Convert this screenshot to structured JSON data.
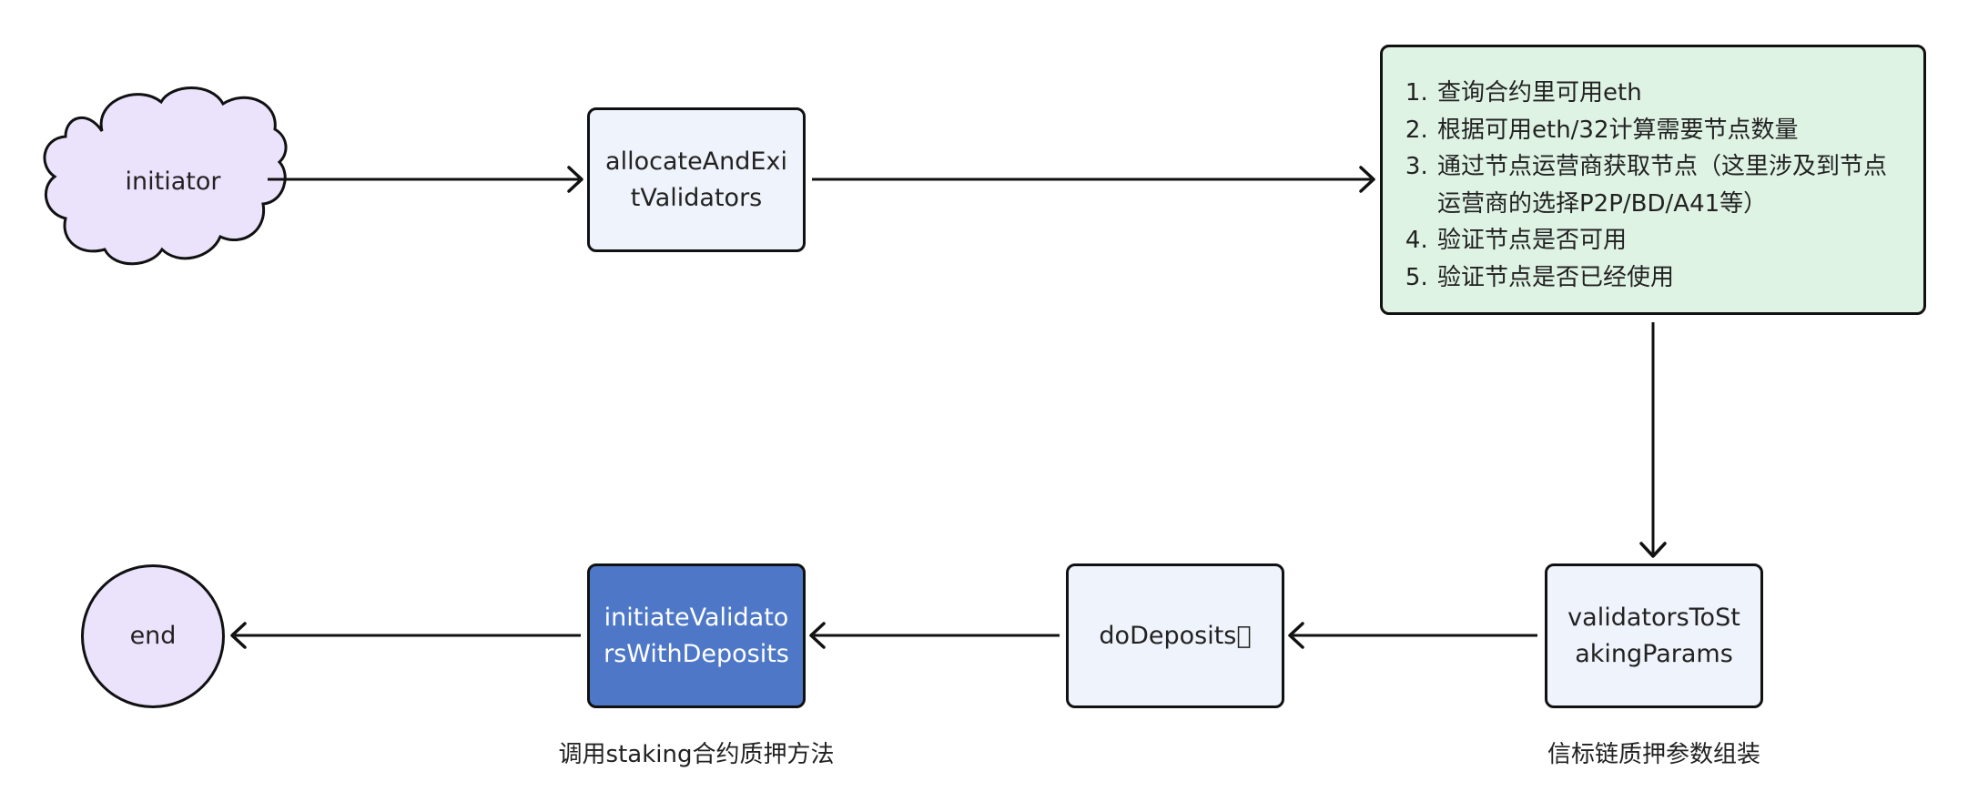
{
  "nodes": {
    "initiator": "initiator",
    "allocate": "allocateAndExitValidators",
    "validators_to_staking": "validatorsToStakingParams",
    "do_deposits": "doDeposits\u0000",
    "initiate": "initiateValidatorsWithDeposits",
    "end": "end"
  },
  "note": {
    "items": [
      "查询合约里可用eth",
      "根据可用eth/32计算需要节点数量",
      "通过节点运营商获取节点（这里涉及到节点运营商的选择P2P/BD/A41等）",
      "验证节点是否可用",
      "验证节点是否已经使用"
    ]
  },
  "captions": {
    "staking_call": "调用staking合约质押方法",
    "beacon_params": "信标链质押参数组装"
  },
  "colors": {
    "cloud_fill": "#ebe3fb",
    "box_fill": "#eff3fb",
    "note_fill": "#dff3e4",
    "highlight_fill": "#4e78c7",
    "end_fill": "#ebe3fb"
  }
}
